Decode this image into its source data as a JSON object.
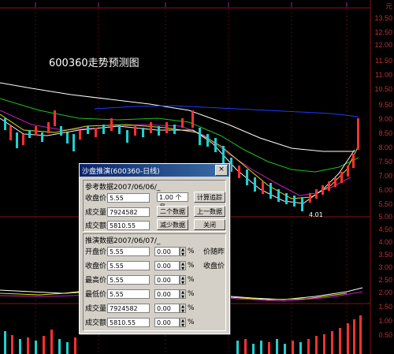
{
  "chart_label": "600360走势预测图",
  "low_price_label": "4.01",
  "y_axis_labels": [
    "13.50",
    "12.50",
    "12.00",
    "11.50",
    "11.00",
    "10.50",
    "9.50",
    "9.00",
    "8.50",
    "8.00",
    "7.50",
    "7.00",
    "6.00",
    "5.50",
    "5.00",
    "4.50",
    "4.00",
    "3.50",
    "3.00",
    "2.50",
    "2.00",
    "1.50",
    "1.00",
    "0.50"
  ],
  "top_corner_label": "元",
  "dialog": {
    "title": "沙盘推演(600360-日线)",
    "close_label": "×",
    "ref_data_label": "参考数据2007/06/06/_",
    "ref_close_label": "收盘价",
    "ref_close_value": "5.55",
    "ref_vol_label": "成交量",
    "ref_vol_value": "7924582",
    "ref_amt_label": "成交额",
    "ref_amt_value": "5810.55",
    "period_value": "1.00 个月",
    "btn_calc_label": "计算追踪",
    "btn_two_label": "二个数据",
    "btn_up_label": "上一数据",
    "btn_step_label": "减少数据",
    "btn_close_label": "关闭",
    "sim_data_label": "推演数据2007/06/07/_",
    "rows": [
      {
        "label": "开盘价",
        "value": "5.55",
        "pct": "0.00",
        "unit": "%"
      },
      {
        "label": "收盘价",
        "value": "5.55",
        "pct": "0.00",
        "unit": "%"
      },
      {
        "label": "最高价",
        "value": "5.55",
        "pct": "0.00",
        "unit": "%"
      },
      {
        "label": "最低价",
        "value": "5.55",
        "pct": "0.00",
        "unit": "%"
      },
      {
        "label": "成交量",
        "value": "7924582",
        "pct": "0.00",
        "unit": "%"
      },
      {
        "label": "成交额",
        "value": "5810.55",
        "pct": "0.00",
        "unit": "%"
      }
    ],
    "side_label_1": "价随昨",
    "side_label_2": "收盘价"
  }
}
